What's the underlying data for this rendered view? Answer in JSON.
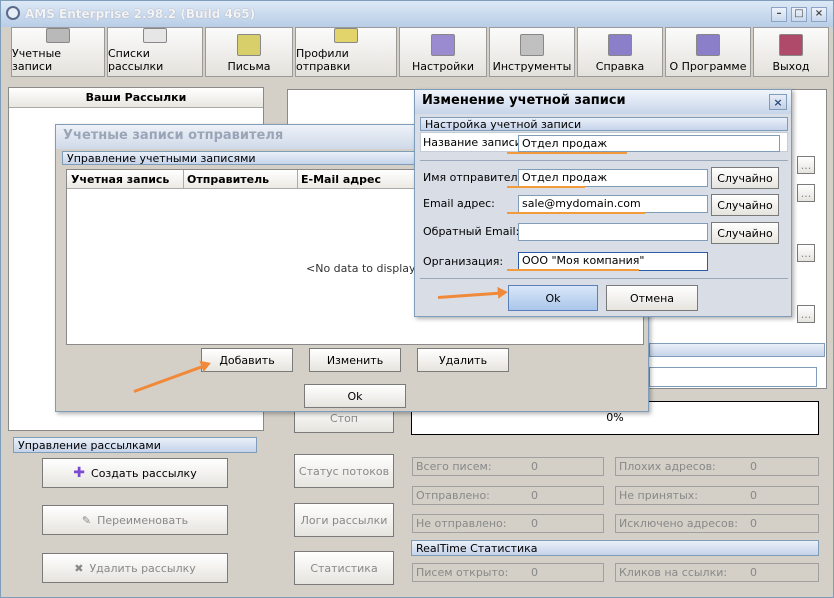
{
  "window": {
    "title": "AMS Enterprise 2.98.2 (Build 465)"
  },
  "toolbar": [
    {
      "label": "Учетные записи"
    },
    {
      "label": "Списки рассылки"
    },
    {
      "label": "Письма"
    },
    {
      "label": "Профили отправки"
    },
    {
      "label": "Настройки"
    },
    {
      "label": "Инструменты"
    },
    {
      "label": "Справка"
    },
    {
      "label": "О Программе"
    },
    {
      "label": "Выход"
    }
  ],
  "left": {
    "header": "Ваши Рассылки",
    "mgmt_header": "Управление рассылками",
    "create": "Создать рассылку",
    "rename": "Переименовать",
    "delete": "Удалить рассылку"
  },
  "right": {
    "stop": "Стоп",
    "thread_status": "Статус потоков",
    "logs": "Логи рассылки",
    "stats": "Статистика",
    "progress": "0%",
    "counters": [
      {
        "label": "Всего писем:",
        "value": "0"
      },
      {
        "label": "Плохих адресов:",
        "value": "0"
      },
      {
        "label": "Отправлено:",
        "value": "0"
      },
      {
        "label": "Не принятых:",
        "value": "0"
      },
      {
        "label": "Не отправлено:",
        "value": "0"
      },
      {
        "label": "Исключено адресов:",
        "value": "0"
      }
    ],
    "realtime_header": "RealTime Статистика",
    "rt": [
      {
        "label": "Писем открыто:",
        "value": "0"
      },
      {
        "label": "Кликов на ссылки:",
        "value": "0"
      }
    ],
    "ellipsis": "..."
  },
  "senders": {
    "title": "Учетные записи отправителя",
    "section": "Управление учетными записями",
    "columns": [
      "Учетная запись",
      "Отправитель",
      "E-Mail адрес"
    ],
    "empty": "<No data to display>",
    "add": "Добавить",
    "edit": "Изменить",
    "remove": "Удалить",
    "ok": "Ok"
  },
  "edit": {
    "title": "Изменение учетной записи",
    "close": "×",
    "section": "Настройка учетной записи",
    "name_label": "Название записи:",
    "name_value": "Отдел продаж",
    "sender_label": "Имя отправителя:",
    "sender_value": "Отдел продаж",
    "email_label": "Email адрес:",
    "email_value": "sale@mydomain.com",
    "reply_label": "Обратный Email:",
    "reply_value": "",
    "org_label": "Организация:",
    "org_value": "ООО \"Моя компания\"",
    "random": "Случайно",
    "ok": "Ok",
    "cancel": "Отмена"
  }
}
